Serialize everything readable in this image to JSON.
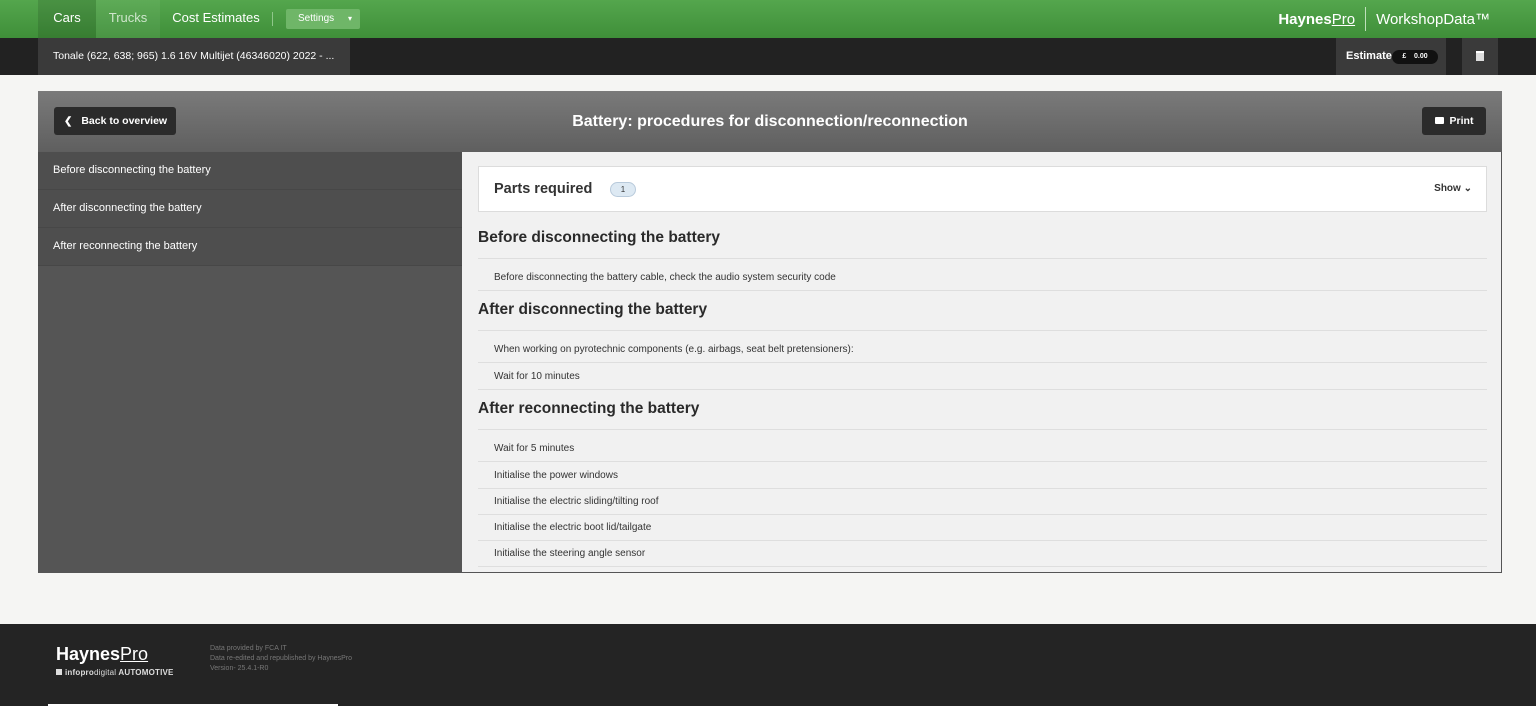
{
  "nav": {
    "tabs": [
      "Cars",
      "Trucks",
      "Cost Estimates"
    ],
    "settings_label": "Settings",
    "brand_bold": "Haynes",
    "brand_pro": "Pro",
    "brand_product": "WorkshopData™"
  },
  "vehicle": {
    "label": "Tonale (622, 638; 965) 1.6 16V Multijet (46346020) 2022 - ..."
  },
  "estimate": {
    "label": "Estimate",
    "currency": "£",
    "amount": "0.00"
  },
  "panel": {
    "back_label": "Back to overview",
    "title": "Battery: procedures for disconnection/reconnection",
    "print_label": "Print"
  },
  "sidebar": {
    "items": [
      "Before disconnecting the battery",
      "After disconnecting the battery",
      "After reconnecting the battery"
    ]
  },
  "parts": {
    "title": "Parts required",
    "count": "1",
    "toggle_label": "Show"
  },
  "sections": [
    {
      "heading": "Before disconnecting the battery",
      "rows": [
        "Before disconnecting the battery cable, check the audio system security code"
      ]
    },
    {
      "heading": "After disconnecting the battery",
      "rows": [
        "When working on pyrotechnic components (e.g. airbags, seat belt pretensioners):",
        "Wait for 10 minutes"
      ]
    },
    {
      "heading": "After reconnecting the battery",
      "rows": [
        "Wait for 5 minutes",
        "Initialise the power windows",
        "Initialise the electric sliding/tilting roof",
        "Initialise the electric boot lid/tailgate",
        "Initialise the steering angle sensor"
      ]
    }
  ],
  "footer": {
    "logo_bold": "Haynes",
    "logo_pro": "Pro",
    "sublogo_a": "infopro",
    "sublogo_b": "digital",
    "sublogo_c": "AUTOMOTIVE",
    "info": [
      "Data provided by FCA IT",
      "Data re-edited and republished by HaynesPro",
      "Version- 25.4.1-R0"
    ]
  },
  "colors": {
    "nav_green": "#4a9b43",
    "dark_bar": "#222222",
    "panel_grey": "#555555"
  }
}
